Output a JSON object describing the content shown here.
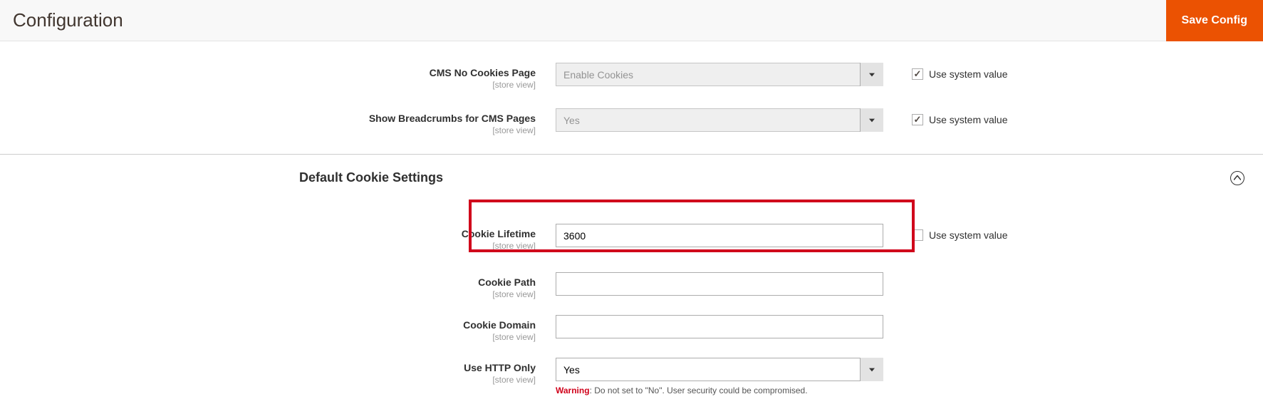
{
  "header": {
    "title": "Configuration",
    "save_button": "Save Config"
  },
  "scope_label": "[store view]",
  "use_system_value": "Use system value",
  "upper_fields": {
    "cms_no_cookies": {
      "label": "CMS No Cookies Page",
      "value": "Enable Cookies"
    },
    "show_breadcrumbs": {
      "label": "Show Breadcrumbs for CMS Pages",
      "value": "Yes"
    }
  },
  "section": {
    "title": "Default Cookie Settings"
  },
  "cookie_fields": {
    "lifetime": {
      "label": "Cookie Lifetime",
      "value": "3600"
    },
    "path": {
      "label": "Cookie Path",
      "value": ""
    },
    "domain": {
      "label": "Cookie Domain",
      "value": ""
    },
    "http_only": {
      "label": "Use HTTP Only",
      "value": "Yes"
    }
  },
  "warning": {
    "prefix": "Warning",
    "text": ": Do not set to \"No\". User security could be compromised."
  }
}
